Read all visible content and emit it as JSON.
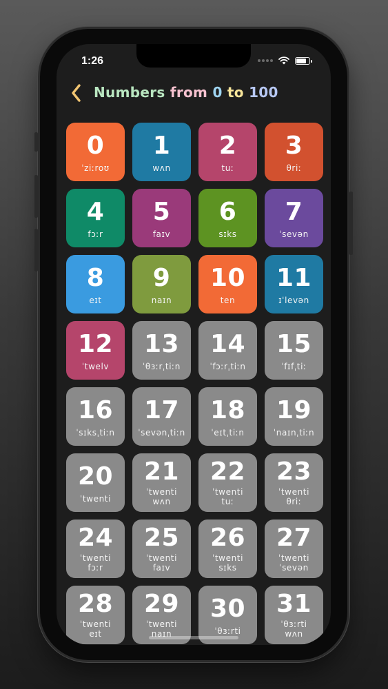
{
  "status_bar": {
    "time": "1:26",
    "battery_level": 0.85
  },
  "header": {
    "back_icon": "chevron-left-icon",
    "title_parts": [
      "Numbers ",
      "from ",
      "0 ",
      "to ",
      "100"
    ],
    "title_colors": [
      "#b9e6c0",
      "#f6c1cf",
      "#9fd5f2",
      "#f7e59a",
      "#b7c8f4"
    ],
    "accent": "#f2c572"
  },
  "tiles": [
    {
      "number": "0",
      "ipa": "ˈziːroʊ",
      "color": "#f26a36"
    },
    {
      "number": "1",
      "ipa": "wʌn",
      "color": "#1f7aa3"
    },
    {
      "number": "2",
      "ipa": "tuː",
      "color": "#b5456b"
    },
    {
      "number": "3",
      "ipa": "θriː",
      "color": "#d2512f"
    },
    {
      "number": "4",
      "ipa": "fɔːr",
      "color": "#0f8a67"
    },
    {
      "number": "5",
      "ipa": "faɪv",
      "color": "#9a3a7a"
    },
    {
      "number": "6",
      "ipa": "sɪks",
      "color": "#5d9322"
    },
    {
      "number": "7",
      "ipa": "ˈsevən",
      "color": "#6b4a9d"
    },
    {
      "number": "8",
      "ipa": "eɪt",
      "color": "#3a9be0"
    },
    {
      "number": "9",
      "ipa": "naɪn",
      "color": "#7f9b3e"
    },
    {
      "number": "10",
      "ipa": "ten",
      "color": "#f26a36"
    },
    {
      "number": "11",
      "ipa": "ɪˈlevən",
      "color": "#1f7aa3"
    },
    {
      "number": "12",
      "ipa": "ˈtwelv",
      "color": "#b5456b"
    },
    {
      "number": "13",
      "ipa": "ˈθɜːrˌtiːn",
      "color": "#8a8a8a"
    },
    {
      "number": "14",
      "ipa": "ˈfɔːrˌtiːn",
      "color": "#8a8a8a"
    },
    {
      "number": "15",
      "ipa": "ˈfɪfˌtiː",
      "color": "#8a8a8a"
    },
    {
      "number": "16",
      "ipa": "ˈsɪksˌtiːn",
      "color": "#8a8a8a"
    },
    {
      "number": "17",
      "ipa": "ˈsevənˌtiːn",
      "color": "#8a8a8a"
    },
    {
      "number": "18",
      "ipa": "ˈeɪtˌtiːn",
      "color": "#8a8a8a"
    },
    {
      "number": "19",
      "ipa": "ˈnaɪnˌtiːn",
      "color": "#8a8a8a"
    },
    {
      "number": "20",
      "ipa": "ˈtwenti",
      "color": "#8a8a8a"
    },
    {
      "number": "21",
      "ipa": "ˈtwenti\nwʌn",
      "color": "#8a8a8a"
    },
    {
      "number": "22",
      "ipa": "ˈtwenti\ntuː",
      "color": "#8a8a8a"
    },
    {
      "number": "23",
      "ipa": "ˈtwenti\nθriː",
      "color": "#8a8a8a"
    },
    {
      "number": "24",
      "ipa": "ˈtwenti\nfɔːr",
      "color": "#8a8a8a"
    },
    {
      "number": "25",
      "ipa": "ˈtwenti\nfaɪv",
      "color": "#8a8a8a"
    },
    {
      "number": "26",
      "ipa": "ˈtwenti\nsɪks",
      "color": "#8a8a8a"
    },
    {
      "number": "27",
      "ipa": "ˈtwenti\nˈsevən",
      "color": "#8a8a8a"
    },
    {
      "number": "28",
      "ipa": "ˈtwenti\neɪt",
      "color": "#8a8a8a"
    },
    {
      "number": "29",
      "ipa": "ˈtwenti\nnaɪn",
      "color": "#8a8a8a"
    },
    {
      "number": "30",
      "ipa": "ˈθɜːrti",
      "color": "#8a8a8a"
    },
    {
      "number": "31",
      "ipa": "ˈθɜːrti\nwʌn",
      "color": "#8a8a8a"
    }
  ]
}
